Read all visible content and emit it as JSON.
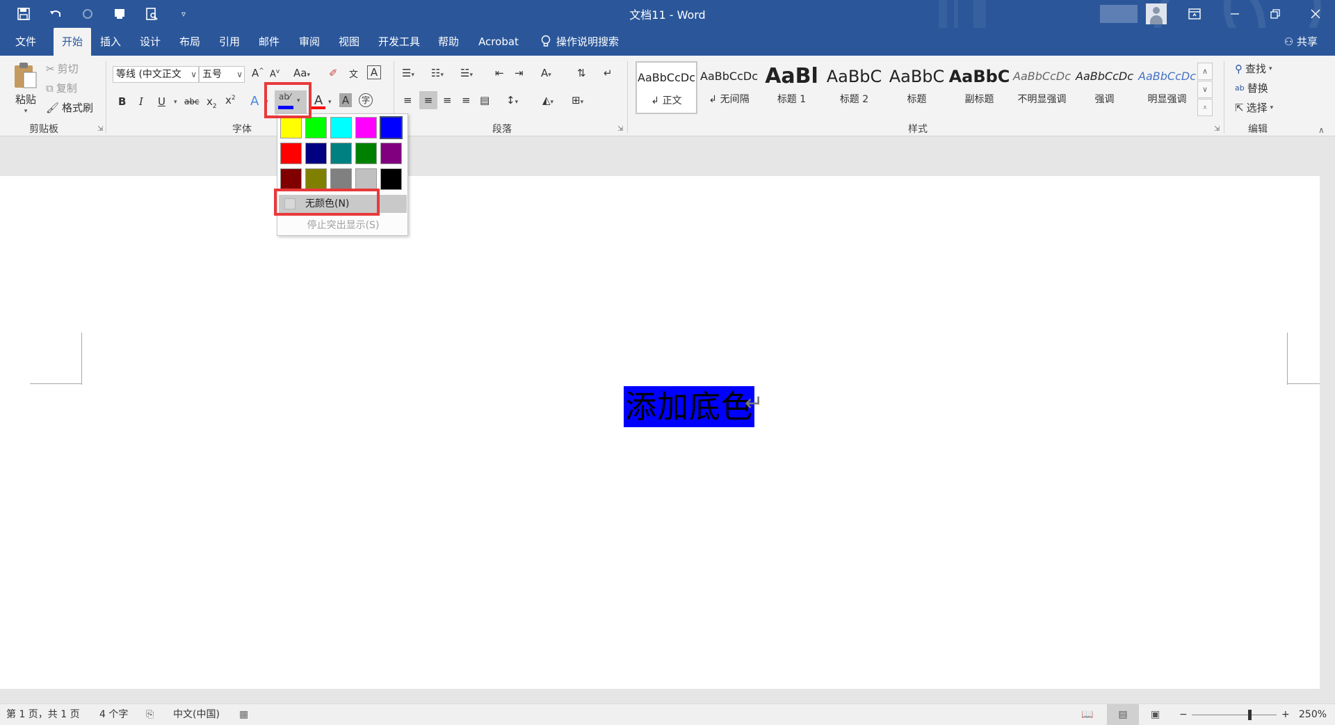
{
  "window": {
    "title": "文档11 - Word"
  },
  "qat": {
    "icons": [
      "save-icon",
      "undo-icon",
      "redo-icon",
      "touch-mode-icon",
      "print-preview-icon",
      "customize-icon"
    ]
  },
  "tabs": [
    {
      "label": "文件",
      "active": false
    },
    {
      "label": "开始",
      "active": true
    },
    {
      "label": "插入",
      "active": false
    },
    {
      "label": "设计",
      "active": false
    },
    {
      "label": "布局",
      "active": false
    },
    {
      "label": "引用",
      "active": false
    },
    {
      "label": "邮件",
      "active": false
    },
    {
      "label": "审阅",
      "active": false
    },
    {
      "label": "视图",
      "active": false
    },
    {
      "label": "开发工具",
      "active": false
    },
    {
      "label": "帮助",
      "active": false
    },
    {
      "label": "Acrobat",
      "active": false
    }
  ],
  "search_tab": {
    "label": "操作说明搜索"
  },
  "share": {
    "label": "共享"
  },
  "clipboard": {
    "paste": "粘贴",
    "cut": "剪切",
    "copy": "复制",
    "format_painter": "格式刷",
    "group_label": "剪贴板"
  },
  "font": {
    "name": "等线 (中文正文",
    "size": "五号",
    "group_label": "字体",
    "highlight_color": "#0000ff",
    "font_color": "#ff0000"
  },
  "paragraph": {
    "group_label": "段落"
  },
  "styles": {
    "group_label": "样式",
    "items": [
      {
        "sample": "AaBbCcDc",
        "name": "↲ 正文"
      },
      {
        "sample": "AaBbCcDc",
        "name": "↲ 无间隔"
      },
      {
        "sample": "AaBl",
        "name": "标题 1"
      },
      {
        "sample": "AaBbC",
        "name": "标题 2"
      },
      {
        "sample": "AaBbC",
        "name": "标题"
      },
      {
        "sample": "AaBbC",
        "name": "副标题"
      },
      {
        "sample": "AaBbCcDc",
        "name": "不明显强调"
      },
      {
        "sample": "AaBbCcDc",
        "name": "强调"
      },
      {
        "sample": "AaBbCcDc",
        "name": "明显强调"
      }
    ]
  },
  "editing": {
    "find": "查找",
    "replace": "替换",
    "select": "选择",
    "group_label": "编辑"
  },
  "highlight_menu": {
    "colors": [
      [
        "#ffff00",
        "#00ff00",
        "#00ffff",
        "#ff00ff",
        "#0000ff"
      ],
      [
        "#ff0000",
        "#000080",
        "#008080",
        "#008000",
        "#800080"
      ],
      [
        "#800000",
        "#808000",
        "#808080",
        "#c0c0c0",
        "#000000"
      ]
    ],
    "selected": "#0000ff",
    "no_color": "无颜色(N)",
    "stop": "停止突出显示(S)"
  },
  "document": {
    "text": "添加底色",
    "highlight": "#0000ff",
    "para_mark": "↵"
  },
  "status": {
    "page": "第 1 页，共 1 页",
    "words": "4 个字",
    "language": "中文(中国)",
    "zoom_minus": "−",
    "zoom_plus": "+",
    "zoom": "250%"
  }
}
